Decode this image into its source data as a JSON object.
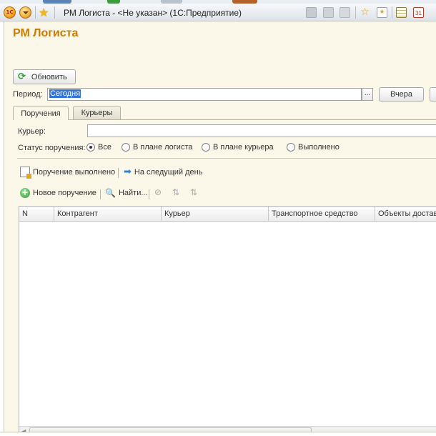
{
  "window": {
    "title": "РМ Логиста -  <Не указан>  (1С:Предприятие)"
  },
  "form": {
    "title": "РМ Логиста",
    "refresh_label": "Обновить",
    "period_label": "Период:",
    "period_value": "Сегодня",
    "ellipsis_label": "...",
    "yesterday_label": "Вчера"
  },
  "tabs": [
    {
      "label": "Поручения",
      "active": true
    },
    {
      "label": "Курьеры",
      "active": false
    }
  ],
  "filters": {
    "courier_label": "Курьер:",
    "courier_value": "",
    "status_label": "Статус поручения:",
    "status_options": [
      {
        "label": "Все",
        "selected": true
      },
      {
        "label": "В плане логиста",
        "selected": false
      },
      {
        "label": "В плане курьера",
        "selected": false
      },
      {
        "label": "Выполнено",
        "selected": false
      }
    ]
  },
  "actions": {
    "done_label": "Поручение выполнено",
    "next_day_label": "На следущий день",
    "new_label": "Новое поручение",
    "find_label": "Найти..."
  },
  "table": {
    "columns": [
      "N",
      "Контрагент",
      "Курьер",
      "Транспортное средство",
      "Объекты достав"
    ],
    "rows": []
  },
  "colors": {
    "title_orange": "#cc7a00",
    "form_bg": "#fbf8ea",
    "selection_blue": "#3375d6"
  }
}
